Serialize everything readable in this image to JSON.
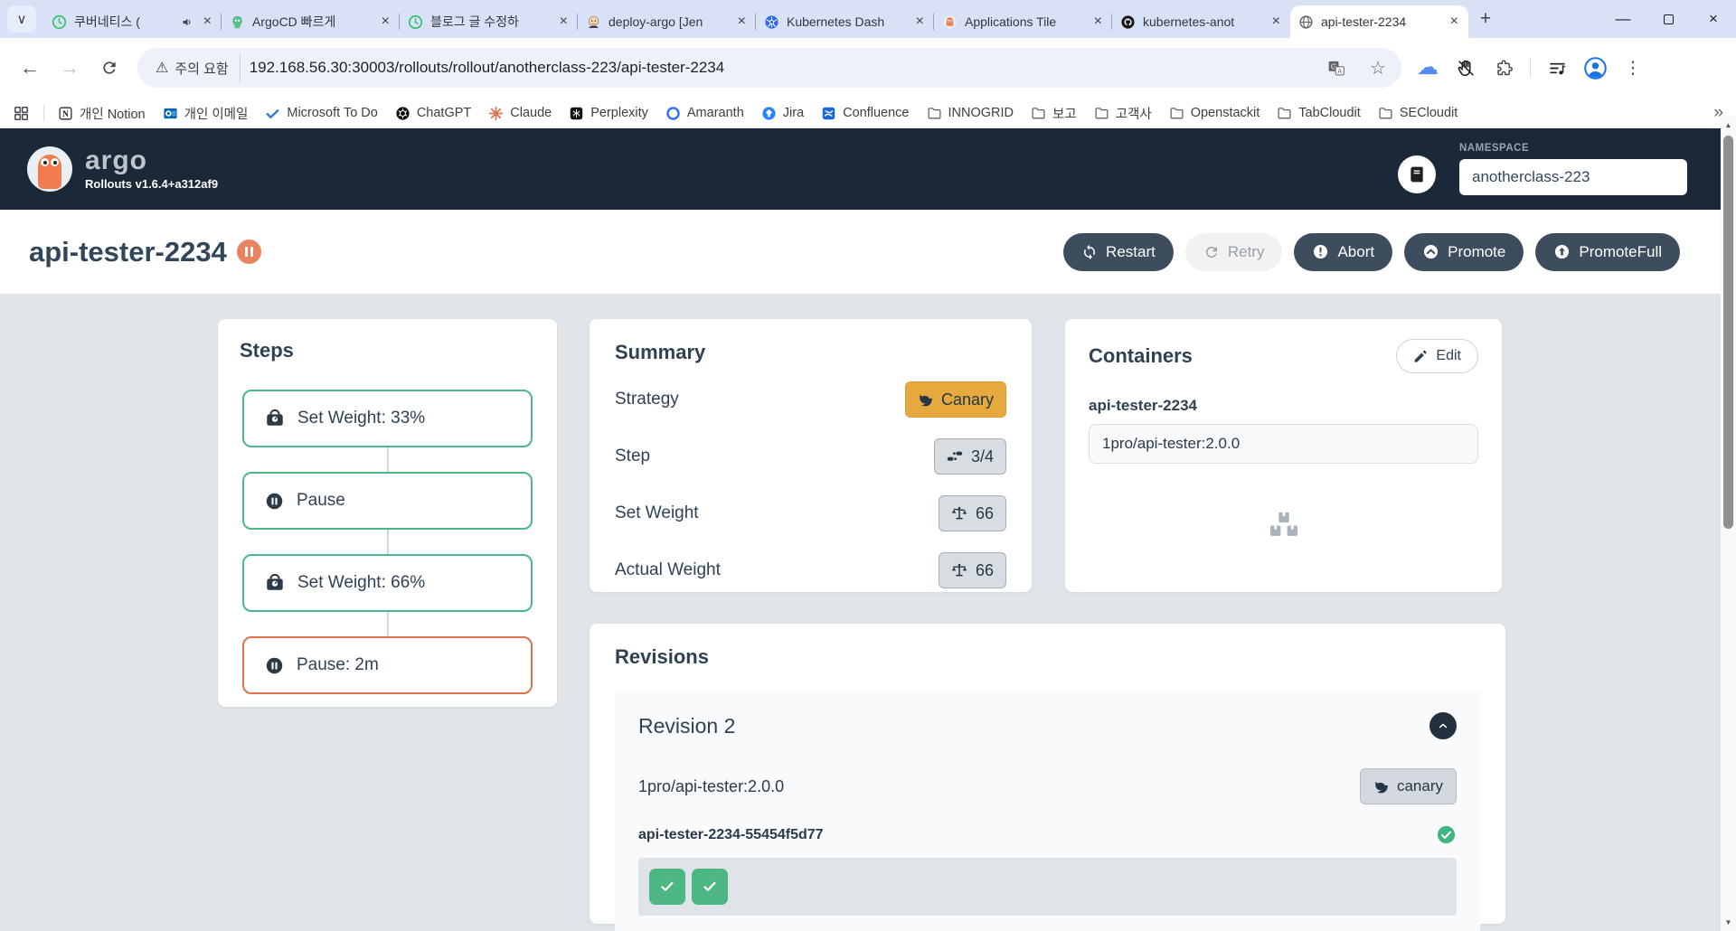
{
  "browser": {
    "tabs": [
      {
        "title": "쿠버네티스 (",
        "favicon": "clock-green-icon",
        "audio": true
      },
      {
        "title": "ArgoCD 빠르게",
        "favicon": "argocd-icon"
      },
      {
        "title": "블로그 글 수정하",
        "favicon": "clock-green-icon"
      },
      {
        "title": "deploy-argo [Jen",
        "favicon": "jenkins-icon"
      },
      {
        "title": "Kubernetes Dash",
        "favicon": "kubernetes-icon"
      },
      {
        "title": "Applications Tile",
        "favicon": "argo-icon"
      },
      {
        "title": "kubernetes-anot",
        "favicon": "github-icon"
      },
      {
        "title": "api-tester-2234",
        "favicon": "globe-icon",
        "active": true
      }
    ],
    "address": {
      "warning_label": "주의 요함",
      "url": "192.168.56.30:30003/rollouts/rollout/anotherclass-223/api-tester-2234"
    },
    "bookmarks": {
      "items": [
        {
          "label": "개인 Notion",
          "icon": "notion-icon"
        },
        {
          "label": "개인 이메일",
          "icon": "outlook-icon"
        },
        {
          "label": "Microsoft To Do",
          "icon": "todo-icon"
        },
        {
          "label": "ChatGPT",
          "icon": "chatgpt-icon"
        },
        {
          "label": "Claude",
          "icon": "claude-icon"
        },
        {
          "label": "Perplexity",
          "icon": "perplexity-icon"
        },
        {
          "label": "Amaranth",
          "icon": "amaranth-icon"
        },
        {
          "label": "Jira",
          "icon": "jira-icon"
        },
        {
          "label": "Confluence",
          "icon": "confluence-icon"
        },
        {
          "label": "INNOGRID",
          "icon": "folder-icon"
        },
        {
          "label": "보고",
          "icon": "folder-icon"
        },
        {
          "label": "고객사",
          "icon": "folder-icon"
        },
        {
          "label": "Openstackit",
          "icon": "folder-icon"
        },
        {
          "label": "TabCloudit",
          "icon": "folder-icon"
        },
        {
          "label": "SECloudit",
          "icon": "folder-icon"
        }
      ]
    }
  },
  "header": {
    "logo_text": "argo",
    "version": "Rollouts v1.6.4+a312af9",
    "namespace_label": "NAMESPACE",
    "namespace_value": "anotherclass-223"
  },
  "page": {
    "title": "api-tester-2234",
    "status_icon": "pause-icon",
    "actions": {
      "restart": "Restart",
      "retry": "Retry",
      "abort": "Abort",
      "promote": "Promote",
      "promote_full": "PromoteFull"
    },
    "steps": {
      "title": "Steps",
      "items": [
        {
          "label": "Set Weight: 33%",
          "icon": "weight-scale-icon",
          "state": "ok"
        },
        {
          "label": "Pause",
          "icon": "pause-circle-icon",
          "state": "ok"
        },
        {
          "label": "Set Weight: 66%",
          "icon": "weight-scale-icon",
          "state": "ok"
        },
        {
          "label": "Pause: 2m",
          "icon": "pause-circle-icon",
          "state": "current"
        }
      ]
    },
    "summary": {
      "title": "Summary",
      "rows": [
        {
          "label": "Strategy",
          "value": "Canary",
          "icon": "dove-icon",
          "style": "gold"
        },
        {
          "label": "Step",
          "value": "3/4",
          "icon": "shoe-prints-icon",
          "style": "gray"
        },
        {
          "label": "Set Weight",
          "value": "66",
          "icon": "scale-unbalanced-icon",
          "style": "gray"
        },
        {
          "label": "Actual Weight",
          "value": "66",
          "icon": "scale-balanced-icon",
          "style": "gray"
        }
      ]
    },
    "containers": {
      "title": "Containers",
      "edit_label": "Edit",
      "container_name": "api-tester-2234",
      "image": "1pro/api-tester:2.0.0"
    },
    "revisions": {
      "title": "Revisions",
      "revision": {
        "name": "Revision 2",
        "image": "1pro/api-tester:2.0.0",
        "tag": "canary",
        "replicaset": "api-tester-2234-55454f5d77",
        "pod_count": 2
      }
    }
  },
  "colors": {
    "header_bg": "#1b2837",
    "page_bg": "#dfe5e9",
    "button_dark": "#3e4d5d",
    "success_green": "#4cb787",
    "pause_orange": "#e0714e",
    "canary_gold": "#e5a93d"
  }
}
